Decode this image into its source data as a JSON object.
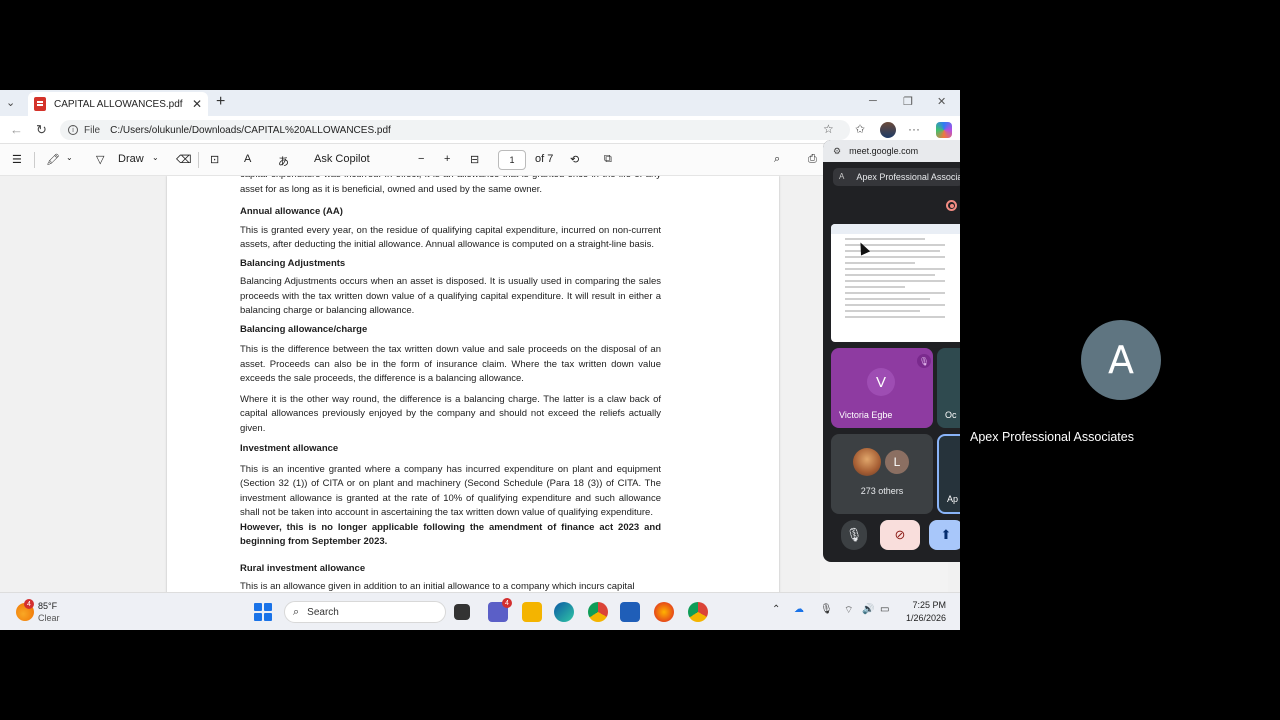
{
  "browser": {
    "tab_title": "CAPITAL ALLOWANCES.pdf",
    "url_scheme": "File",
    "url": "C:/Users/olukunle/Downloads/CAPITAL%20ALLOWANCES.pdf"
  },
  "pdf_toolbar": {
    "draw": "Draw",
    "ask_copilot": "Ask Copilot",
    "page_current": "1",
    "page_total": "of 7"
  },
  "document": {
    "p0": "capital expenditure was incurred. In effect, it is an allowance that is granted once in the life of any asset for as long as it is beneficial, owned and used by the same owner.",
    "h1": "Annual allowance (AA)",
    "p1": "This is granted every year, on the residue of qualifying capital expenditure, incurred on non-current assets, after deducting the initial allowance. Annual allowance is computed on a straight-line basis.",
    "h2": "Balancing Adjustments",
    "p2": "Balancing Adjustments occurs when an asset is disposed. It is usually used in comparing the sales proceeds with the tax written down value of a qualifying capital expenditure. It will result in either a balancing charge or balancing allowance.",
    "h3": "Balancing allowance/charge",
    "p3": "This is the difference between the tax written down value and sale proceeds on the disposal of an asset. Proceeds can also be in the form of insurance claim. Where the tax written down value exceeds the sale proceeds, the difference is a balancing allowance.",
    "p4": "Where it is the other way round, the difference is a balancing charge. The latter is a claw back of capital allowances previously enjoyed by the company and should not exceed the reliefs actually given.",
    "h4": "Investment allowance",
    "p5": "This is an incentive granted where a company has incurred expenditure on plant and equipment (Section 32 (1)) of CITA or on plant and machinery (Second Schedule (Para 18 (3)) of CITA. The investment allowance is granted at the rate of 10% of qualifying expenditure and such allowance shall not be taken into account in ascertaining the tax written down value of qualifying expenditure.",
    "p5_bold": "However, this is no longer applicable following the amendment of finance act 2023 and beginning from September 2023.",
    "h5": "Rural investment allowance",
    "p6": "This is an allowance given in addition to an initial allowance to a company which incurs capital"
  },
  "meet_pip": {
    "domain": "meet.google.com",
    "meeting_avatar": "A",
    "meeting_name": "Apex Professional Associates",
    "tile1_initial": "V",
    "tile1_name": "Victoria Egbe",
    "tile2_name": "Oc",
    "others_initial": "L",
    "others_label": "273 others",
    "tile4_name": "Ap"
  },
  "taskbar": {
    "weather_badge": "4",
    "temperature": "85°F",
    "weather": "Clear",
    "search": "Search",
    "teams_badge": "4",
    "time": "7:25 PM",
    "date": "1/26/2026"
  },
  "participant": {
    "initial": "A",
    "name": "Apex Professional Associates"
  },
  "colors": {
    "accent": "#1a73e8",
    "meet_bg": "#202124",
    "tile_purple": "#8e3ba1",
    "avatar_grey": "#5f7581"
  }
}
